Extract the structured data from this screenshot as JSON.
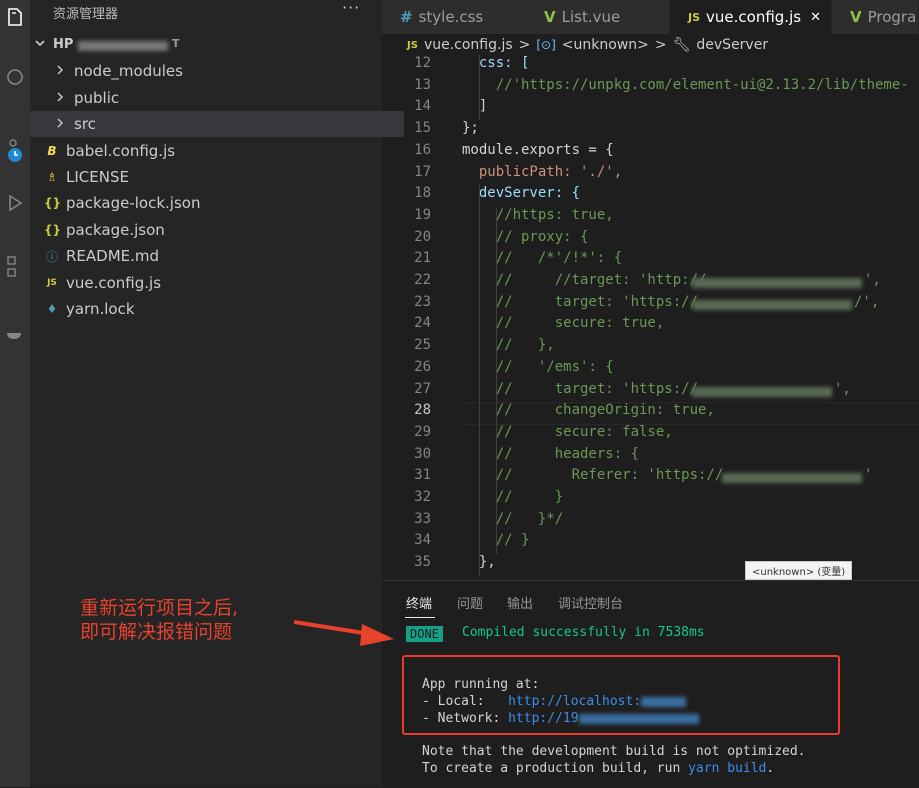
{
  "sidebar": {
    "title": "资源管理器",
    "more": "···",
    "project": "HP",
    "items": [
      {
        "label": "node_modules",
        "icon": "chevron-right-icon"
      },
      {
        "label": "public",
        "icon": "chevron-right-icon"
      },
      {
        "label": "src",
        "icon": "chevron-right-icon",
        "selected": true
      },
      {
        "label": "babel.config.js",
        "icon": "babel-icon"
      },
      {
        "label": "LICENSE",
        "icon": "license-icon"
      },
      {
        "label": "package-lock.json",
        "icon": "json-icon"
      },
      {
        "label": "package.json",
        "icon": "json-icon"
      },
      {
        "label": "README.md",
        "icon": "info-icon"
      },
      {
        "label": "vue.config.js",
        "icon": "js-icon"
      },
      {
        "label": "yarn.lock",
        "icon": "yarn-icon"
      }
    ]
  },
  "tabs": [
    {
      "label": "style.css",
      "icon": "#"
    },
    {
      "label": "List.vue",
      "icon": "V"
    },
    {
      "label": "vue.config.js",
      "icon": "JS",
      "close": "✕"
    },
    {
      "label": "Progra",
      "icon": "V"
    }
  ],
  "breadcrumb": {
    "file": "vue.config.js",
    "symbol": "<unknown>",
    "prop": "devServer",
    "sep": ">"
  },
  "code": {
    "current_line": 28,
    "lines": [
      {
        "n": "12",
        "t": "  css: ["
      },
      {
        "n": "13",
        "t": "    //'https://unpkg.com/element-ui@2.13.2/lib/theme-"
      },
      {
        "n": "14",
        "t": "  ]"
      },
      {
        "n": "15",
        "t": "};"
      },
      {
        "n": "16",
        "t": "module.exports = {"
      },
      {
        "n": "17",
        "t": "  publicPath: './',"
      },
      {
        "n": "18",
        "t": "  devServer: {"
      },
      {
        "n": "19",
        "t": "    //https: true,"
      },
      {
        "n": "20",
        "t": "    // proxy: {"
      },
      {
        "n": "21",
        "t": "    //   /*'/!*': {"
      },
      {
        "n": "22",
        "t": "    //     //target: 'http://"
      },
      {
        "n": "23",
        "t": "    //     target: 'https://"
      },
      {
        "n": "24",
        "t": "    //     secure: true,"
      },
      {
        "n": "25",
        "t": "    //   },"
      },
      {
        "n": "26",
        "t": "    //   '/ems': {"
      },
      {
        "n": "27",
        "t": "    //     target: 'https://"
      },
      {
        "n": "28",
        "t": "    //     changeOrigin: true,"
      },
      {
        "n": "29",
        "t": "    //     secure: false,"
      },
      {
        "n": "30",
        "t": "    //     headers: {"
      },
      {
        "n": "31",
        "t": "    //       Referer: 'https://"
      },
      {
        "n": "32",
        "t": "    //     }"
      },
      {
        "n": "33",
        "t": "    //   }*/"
      },
      {
        "n": "34",
        "t": "    // }"
      },
      {
        "n": "35",
        "t": "  },"
      }
    ]
  },
  "hover_tip": "<unknown> (变量)",
  "panel": {
    "tabs": [
      "终端",
      "问题",
      "输出",
      "调试控制台"
    ],
    "done_badge": "DONE",
    "compiled": "Compiled successfully in 7538ms",
    "app_running": "App running at:",
    "local_label": "- Local:   ",
    "local_url": "http://localhost:",
    "network_label": "- Network: ",
    "network_url": "http://19",
    "note1": "Note that the development build is not optimized.",
    "note2_prefix": "To create a production build, run ",
    "note2_cmd": "yarn build",
    "note2_suffix": "."
  },
  "annotation": {
    "line1": "重新运行项目之后,",
    "line2": "即可解决报错问题",
    "color": "#e8412c"
  }
}
